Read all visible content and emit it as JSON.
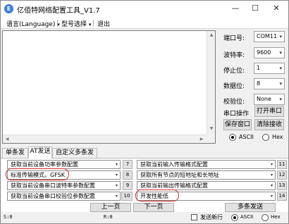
{
  "window": {
    "title": "亿佰特网络配置工具_V1.7",
    "minimize": "—",
    "maximize": "☐",
    "close": "✕"
  },
  "menu": {
    "language": "语言(Language)",
    "model": "型号选择",
    "exit": "退出",
    "dropdown_glyph": "▾"
  },
  "serial": {
    "port_label": "端口号:",
    "port_value": "COM11",
    "baud_label": "波特率:",
    "baud_value": "9600",
    "stop_label": "停止位:",
    "stop_value": "1",
    "data_label": "数据位:",
    "data_value": "8",
    "parity_label": "校验位:",
    "parity_value": "None",
    "op_label": "串口操作",
    "open_button": "打开串口",
    "save_button": "保存窗口",
    "clear_button": "清除接收",
    "rx_ascii": "ASCII",
    "rx_hex": "Hex",
    "rx_selected": "ASCII"
  },
  "tabs": [
    {
      "label": "单条发送"
    },
    {
      "label": "AT发送"
    },
    {
      "label": "自定义多条发送"
    }
  ],
  "active_tab": "AT发送",
  "commands_left": [
    {
      "text": "获取当前设备功率参数配置",
      "num": "7"
    },
    {
      "text": "标准传输模式，GFSK",
      "num": "8"
    },
    {
      "text": "获取当前设备串口波特率参数配置",
      "num": "9"
    },
    {
      "text": "获取当前设备串口校验位参数配置",
      "num": "10"
    }
  ],
  "commands_right": [
    {
      "text": "获取当前输入传输格式配置",
      "num": "11"
    },
    {
      "text": "获取所有节点的短地址和长地址",
      "num": "12"
    },
    {
      "text": "获取当前输出传输格式配置",
      "num": "13"
    },
    {
      "text": "开发性能低",
      "num": "14"
    }
  ],
  "nav": {
    "prev": "上一页",
    "next": "下一页",
    "multi_send": "多条发送"
  },
  "send_options": {
    "newline_label": "发送新行",
    "newline_checked": false,
    "tx_ascii": "ASCII",
    "tx_hex": "Hex",
    "tx_selected": "ASCII"
  },
  "status": {
    "sent": "S:0",
    "received": "R:0"
  },
  "icons": {
    "app": "app-logo-icon",
    "dropdown": "chevron-down-icon",
    "scroll_up": "▲",
    "scroll_down": "▼",
    "scroll_left": "◀",
    "scroll_right": "▶"
  },
  "colors": {
    "highlight": "#d42a2a"
  }
}
